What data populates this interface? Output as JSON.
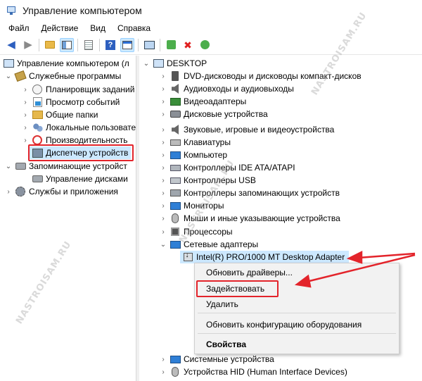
{
  "window": {
    "title": "Управление компьютером"
  },
  "menu": [
    "Файл",
    "Действие",
    "Вид",
    "Справка"
  ],
  "toolbar": {
    "buttons": [
      "back-arrow-icon",
      "forward-arrow-icon",
      "up-folder-icon",
      "show-hide-tree-icon",
      "properties-icon",
      "help-icon",
      "show-hide-action-pane-icon",
      "scan-hardware-icon",
      "update-driver-icon",
      "uninstall-device-icon",
      "enable-device-icon"
    ]
  },
  "left_tree": {
    "root": "Управление компьютером (л",
    "system_tools": "Служебные программы",
    "task_scheduler": "Планировщик заданий",
    "event_viewer": "Просмотр событий",
    "shared_folders": "Общие папки",
    "local_users": "Локальные пользовате",
    "performance": "Производительность",
    "device_manager": "Диспетчер устройств",
    "storage": "Запоминающие устройст",
    "disk_management": "Управление дисками",
    "services": "Службы и приложения"
  },
  "device_tree": {
    "root": "DESKTOP",
    "categories": [
      "DVD-дисководы и дисководы компакт-дисков",
      "Аудиовходы и аудиовыходы",
      "Видеоадаптеры",
      "Дисковые устройства",
      "Звуковые, игровые и видеоустройства",
      "Клавиатуры",
      "Компьютер",
      "Контроллеры IDE ATA/ATAPI",
      "Контроллеры USB",
      "Контроллеры запоминающих устройств",
      "Мониторы",
      "Мыши и иные указывающие устройства",
      "Процессоры",
      "Сетевые адаптеры"
    ],
    "network_device": "Intel(R) PRO/1000 MT Desktop Adapter",
    "after": [
      "Системные устройства",
      "Устройства HID (Human Interface Devices)"
    ]
  },
  "context_menu": {
    "update_drivers": "Обновить драйверы...",
    "enable": "Задействовать",
    "delete": "Удалить",
    "scan": "Обновить конфигурацию оборудования",
    "properties": "Свойства"
  },
  "watermark": "NASTROISAM.RU",
  "colors": {
    "highlight": "#e3242b",
    "selection": "#cce8ff"
  }
}
